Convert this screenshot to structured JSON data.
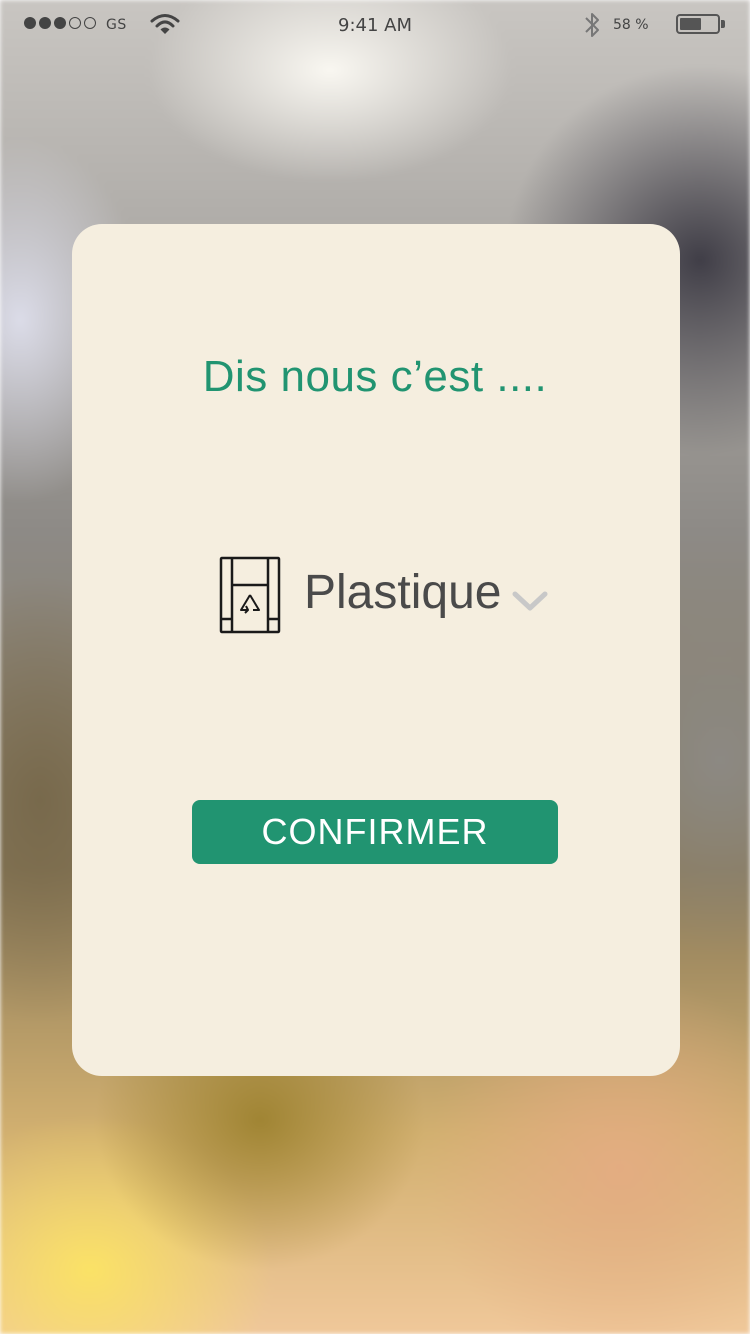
{
  "status_bar": {
    "signal_strength": 3,
    "signal_max": 5,
    "carrier": "GS",
    "time": "9:41 AM",
    "battery_percent_text": "58 %",
    "battery_level": 0.58,
    "icons": [
      "wifi-icon",
      "bluetooth-icon",
      "battery-icon"
    ]
  },
  "dialog": {
    "title": "Dis nous c’est ....",
    "selector": {
      "icon": "plastic-bag-icon",
      "selected_value": "Plastique",
      "dropdown_icon": "chevron-down-icon"
    },
    "confirm_label": "CONFIRMER"
  },
  "colors": {
    "accent": "#219471",
    "card_background": "#f5eedf",
    "text_dark": "#4a4a4a",
    "chevron": "#c8c8c8"
  }
}
